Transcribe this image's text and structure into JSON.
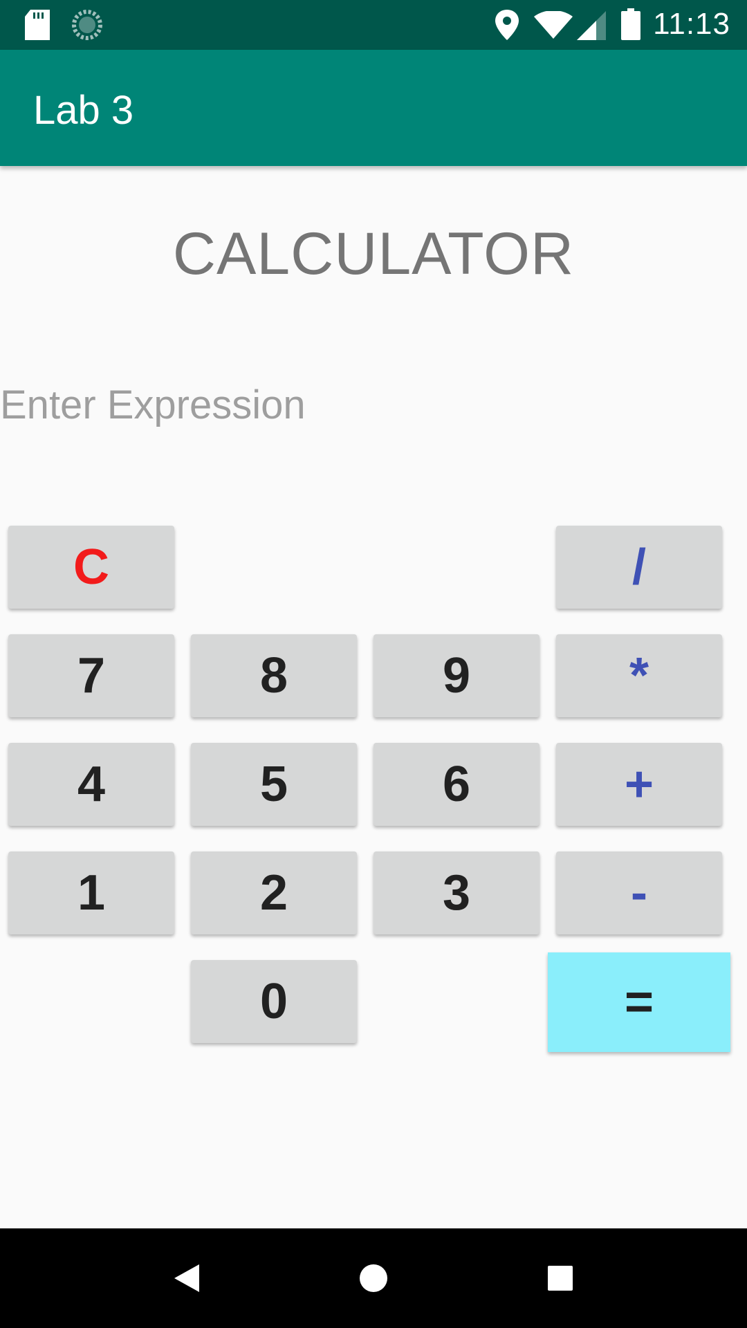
{
  "status_bar": {
    "time": "11:13",
    "icons": [
      "sd-card-icon",
      "sync-icon",
      "location-icon",
      "wifi-icon",
      "signal-icon",
      "battery-icon"
    ]
  },
  "app_bar": {
    "title": "Lab 3"
  },
  "main": {
    "heading": "CALCULATOR",
    "input": {
      "value": "",
      "placeholder": "Enter Expression"
    },
    "keys": {
      "clear": "C",
      "divide": "/",
      "seven": "7",
      "eight": "8",
      "nine": "9",
      "multiply": "*",
      "four": "4",
      "five": "5",
      "six": "6",
      "plus": "+",
      "one": "1",
      "two": "2",
      "three": "3",
      "minus": "-",
      "zero": "0",
      "equals": "="
    }
  },
  "nav_bar": {
    "icons": [
      "back-icon",
      "home-icon",
      "recents-icon"
    ]
  },
  "colors": {
    "status_bar": "#00574b",
    "app_bar": "#008577",
    "key_bg": "#d6d7d7",
    "operator": "#3f51b5",
    "clear": "#f21b1b",
    "equals_bg": "#8aeefb"
  }
}
